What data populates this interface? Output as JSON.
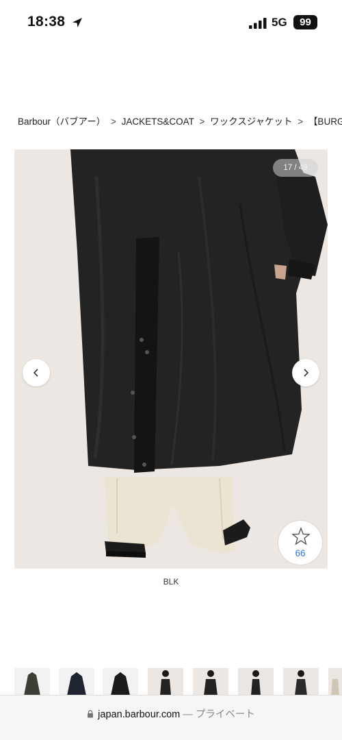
{
  "status_bar": {
    "time": "18:38",
    "network": "5G",
    "battery": "99",
    "icons": [
      "location-arrow-icon",
      "signal-bars-icon"
    ]
  },
  "breadcrumb": [
    {
      "label": "Barbour（バブアー）"
    },
    {
      "label": "JACKETS&COAT"
    },
    {
      "label": "ワックスジャケット"
    },
    {
      "label": "【BURGHL"
    }
  ],
  "breadcrumb_separator": ">",
  "gallery": {
    "counter": "17 / 49",
    "prev_icon": "chevron-left-icon",
    "next_icon": "chevron-right-icon",
    "image": "black-waxed-long-coat-back-view"
  },
  "favorite": {
    "count": "66",
    "icon": "star-outline-icon"
  },
  "color_label": "BLK",
  "thumbnails": [
    {
      "name": "coat-olive"
    },
    {
      "name": "coat-navy"
    },
    {
      "name": "coat-black"
    },
    {
      "name": "model-front"
    },
    {
      "name": "model-front-2"
    },
    {
      "name": "model-side"
    },
    {
      "name": "model-back"
    },
    {
      "name": "model-partial"
    }
  ],
  "url_bar": {
    "domain": "japan.barbour.com",
    "suffix": "— プライベート"
  },
  "colors": {
    "link_blue": "#2b7bd0",
    "coat_black": "#232323",
    "background_beige": "#ece7e2"
  }
}
